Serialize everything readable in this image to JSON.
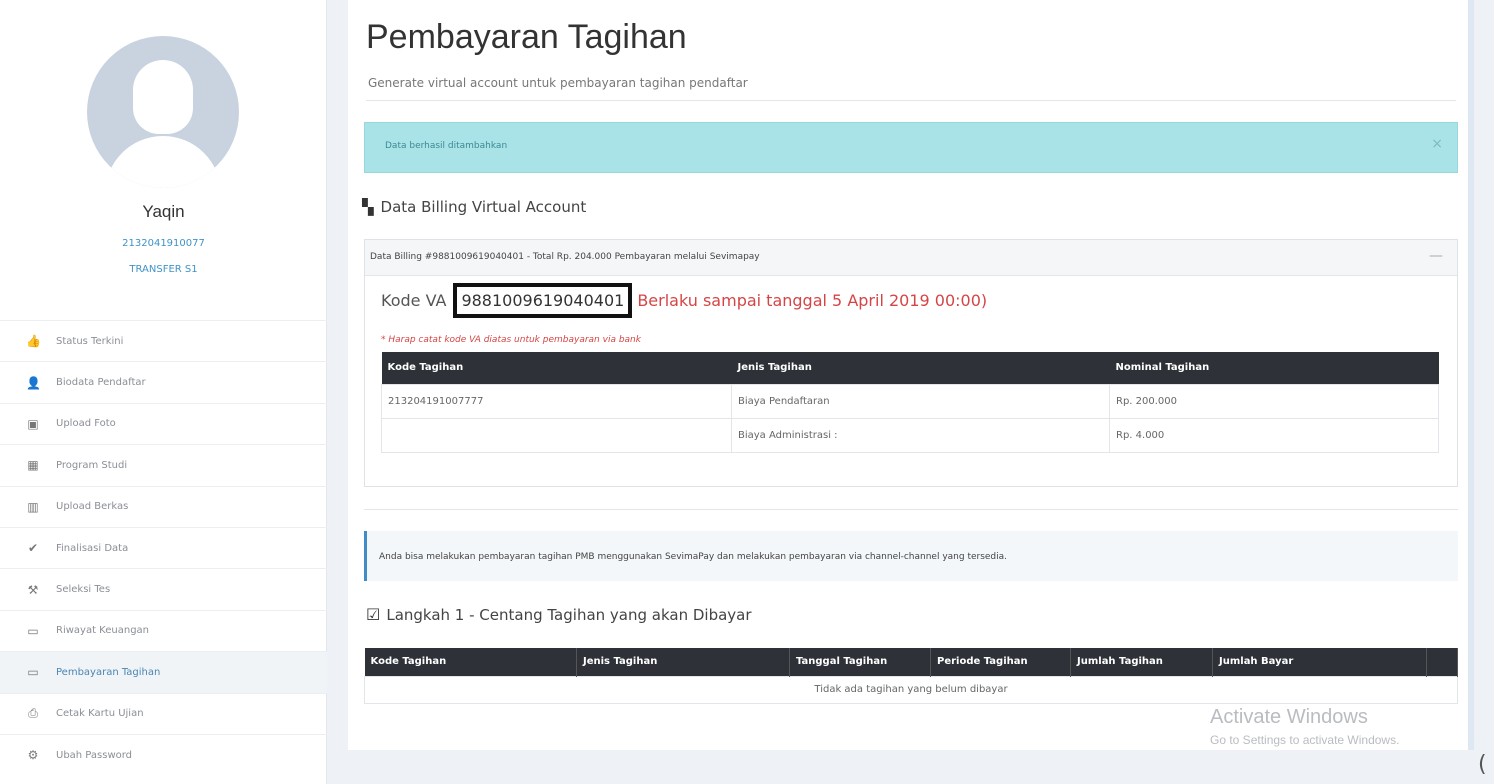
{
  "sidebar": {
    "profile": {
      "name": "Yaqin",
      "id": "2132041910077",
      "program": "TRANSFER S1"
    },
    "menu": [
      {
        "label": "Status Terkini",
        "icon": "thumbs-up-icon",
        "active": false
      },
      {
        "label": "Biodata Pendaftar",
        "icon": "user-icon",
        "active": false
      },
      {
        "label": "Upload Foto",
        "icon": "image-icon",
        "active": false
      },
      {
        "label": "Program Studi",
        "icon": "table-icon",
        "active": false
      },
      {
        "label": "Upload Berkas",
        "icon": "barcode-icon",
        "active": false
      },
      {
        "label": "Finalisasi Data",
        "icon": "check-icon",
        "active": false
      },
      {
        "label": "Seleksi Tes",
        "icon": "gavel-icon",
        "active": false
      },
      {
        "label": "Riwayat Keuangan",
        "icon": "money-icon",
        "active": false
      },
      {
        "label": "Pembayaran Tagihan",
        "icon": "money-icon",
        "active": true
      },
      {
        "label": "Cetak Kartu Ujian",
        "icon": "print-icon",
        "active": false
      },
      {
        "label": "Ubah Password",
        "icon": "gear-icon",
        "active": false
      }
    ]
  },
  "header": {
    "title": "Pembayaran Tagihan",
    "subtitle": "Generate virtual account untuk pembayaran tagihan pendaftar"
  },
  "alert": {
    "text": "Data berhasil ditambahkan",
    "close": "×"
  },
  "billing": {
    "section_title": "Data Billing Virtual Account",
    "panel_header": "Data Billing #9881009619040401 - Total Rp. 204.000 Pembayaran melalui Sevimapay",
    "collapse": "—",
    "kode_va_label": "Kode VA",
    "kode_va_value": "9881009619040401",
    "valid_until": "Berlaku sampai tanggal 5 April 2019 00:00)",
    "note": "* Harap catat kode VA diatas untuk pembayaran via bank",
    "columns": [
      "Kode Tagihan",
      "Jenis Tagihan",
      "Nominal Tagihan"
    ],
    "rows": [
      [
        "213204191007777",
        "Biaya Pendaftaran",
        "Rp. 200.000"
      ],
      [
        "",
        "Biaya Administrasi :",
        "Rp. 4.000"
      ]
    ]
  },
  "info": {
    "text": "Anda bisa melakukan pembayaran tagihan PMB menggunakan SevimaPay dan melakukan pembayaran via channel-channel yang tersedia."
  },
  "step1": {
    "title": "Langkah 1 - Centang Tagihan yang akan Dibayar",
    "columns": [
      "Kode Tagihan",
      "Jenis Tagihan",
      "Tanggal Tagihan",
      "Periode Tagihan",
      "Jumlah Tagihan",
      "Jumlah Bayar",
      ""
    ],
    "empty": "Tidak ada tagihan yang belum dibayar"
  },
  "watermark": {
    "line1": "Activate Windows",
    "line2": "Go to Settings to activate Windows."
  },
  "corner_char": "("
}
